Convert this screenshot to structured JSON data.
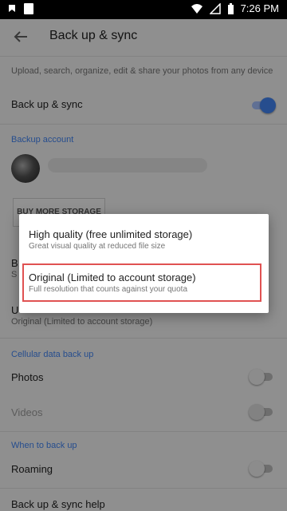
{
  "status_bar": {
    "time": "7:26 PM",
    "icons": [
      "notification-icon",
      "image-icon",
      "wifi-icon",
      "signal-icon",
      "battery-icon"
    ]
  },
  "appbar": {
    "title": "Back up & sync",
    "back_icon": "back-arrow-icon"
  },
  "description": "Upload, search, organize, edit & share your photos from any device",
  "backup_sync": {
    "label": "Back up & sync",
    "enabled": true
  },
  "sections": {
    "backup_account": "Backup account",
    "cellular": "Cellular data back up",
    "when": "When to back up"
  },
  "buy_storage": "BUY MORE STORAGE",
  "obscured": {
    "b_label": "B",
    "b_sub": "S",
    "u_label": "U"
  },
  "upload_size": {
    "value": "Original (Limited to account storage)"
  },
  "cellular": {
    "photos": {
      "label": "Photos",
      "enabled": false
    },
    "videos": {
      "label": "Videos",
      "enabled": false
    }
  },
  "roaming": {
    "label": "Roaming",
    "enabled": false
  },
  "help": "Back up & sync help",
  "dialog": {
    "options": [
      {
        "title": "High quality (free unlimited storage)",
        "subtitle": "Great visual quality at reduced file size"
      },
      {
        "title": "Original (Limited to account storage)",
        "subtitle": "Full resolution that counts against your quota"
      }
    ]
  },
  "colors": {
    "accent": "#4285f4",
    "highlight_box": "#e05252"
  }
}
